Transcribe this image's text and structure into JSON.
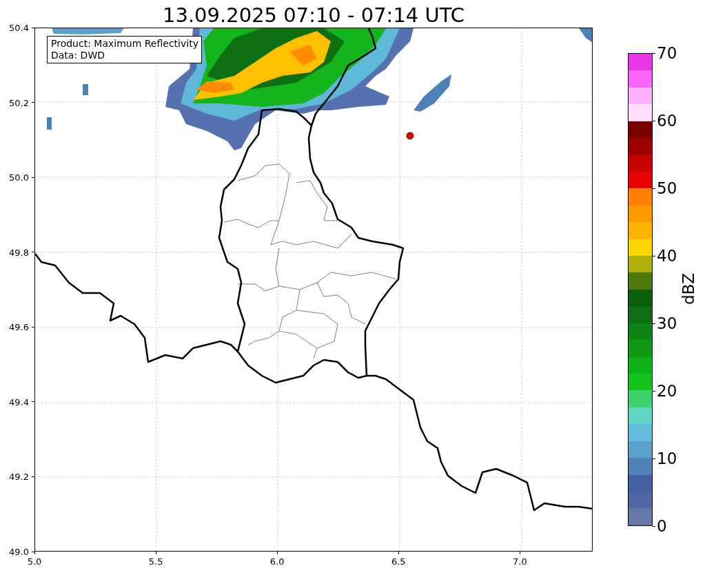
{
  "title": "13.09.2025 07:10 - 07:14 UTC",
  "info_box": {
    "lines": [
      "Product: Maximum Reflectivity",
      "Data: DWD"
    ]
  },
  "x_axis": {
    "ticks": [
      "5.0",
      "5.5",
      "6.0",
      "6.5",
      "7.0"
    ]
  },
  "y_axis": {
    "ticks": [
      "50.4",
      "50.2",
      "50.0",
      "49.8",
      "49.6",
      "49.4",
      "49.2",
      "49.0"
    ]
  },
  "colorbar": {
    "label": "dBZ",
    "ticks": [
      "70",
      "60",
      "50",
      "40",
      "30",
      "20",
      "10",
      "0"
    ],
    "segments": [
      {
        "color": "#e935e9"
      },
      {
        "color": "#f766f7"
      },
      {
        "color": "#ffb0ff"
      },
      {
        "color": "#ffe0ff"
      },
      {
        "color": "#7a0000"
      },
      {
        "color": "#9e0000"
      },
      {
        "color": "#c40000"
      },
      {
        "color": "#e60000"
      },
      {
        "color": "#ff7f00"
      },
      {
        "color": "#ff9900"
      },
      {
        "color": "#ffb300"
      },
      {
        "color": "#ffd700"
      },
      {
        "color": "#b0b00c"
      },
      {
        "color": "#4c7a0c"
      },
      {
        "color": "#0b5c0b"
      },
      {
        "color": "#0d6e12"
      },
      {
        "color": "#0e8414"
      },
      {
        "color": "#0e9a16"
      },
      {
        "color": "#10b018"
      },
      {
        "color": "#12c41c"
      },
      {
        "color": "#3ed26a"
      },
      {
        "color": "#5ed6c4"
      },
      {
        "color": "#62bedc"
      },
      {
        "color": "#5b9fcb"
      },
      {
        "color": "#4d80b6"
      },
      {
        "color": "#4560a4"
      },
      {
        "color": "#5066a0"
      },
      {
        "color": "#6478a8"
      }
    ]
  }
}
